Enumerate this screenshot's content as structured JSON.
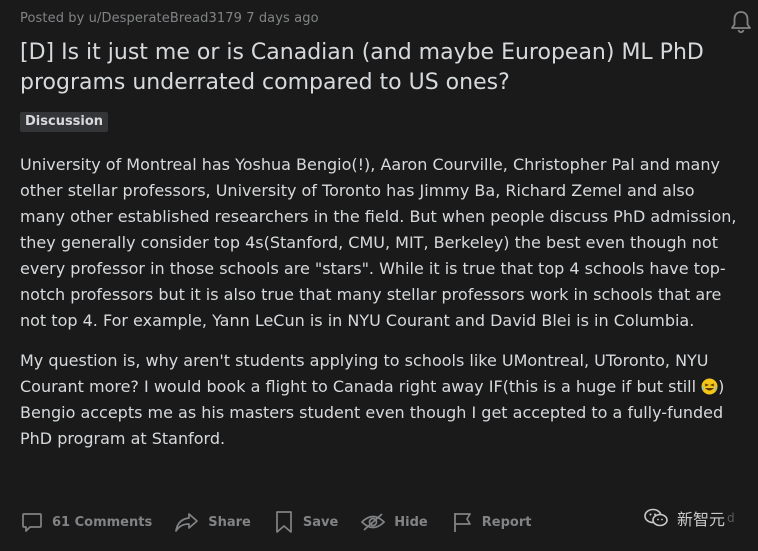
{
  "post": {
    "author_line": "Posted by u/DesperateBread3179 7 days ago",
    "title": "[D] Is it just me or is Canadian (and maybe European) ML PhD programs underrated compared to US ones?",
    "flair": "Discussion",
    "paragraph1": "University of Montreal has Yoshua Bengio(!), Aaron Courville, Christopher Pal and many other stellar professors, University of Toronto has Jimmy Ba, Richard Zemel and also many other established researchers in the field. But when people discuss PhD admission, they generally consider top 4s(Stanford, CMU, MIT, Berkeley) the best even though not every professor in those schools are \"stars\". While it is true that top 4 schools have top-notch professors but it is also true that many stellar professors work in schools that are not top 4. For example, Yann LeCun is in NYU Courant and David Blei is in Columbia.",
    "paragraph2_a": "My question is, why aren't students applying to schools like UMontreal, UToronto, NYU Courant more? I would book a flight to Canada right away IF(this is a huge if but still",
    "paragraph2_b": ") Bengio accepts me as his masters student even though I get accepted to a fully-funded PhD program at Stanford."
  },
  "actions": {
    "comments": "61 Comments",
    "share": "Share",
    "save": "Save",
    "hide": "Hide",
    "report": "Report"
  },
  "watermark": {
    "text": "新智元",
    "faded_text": "d"
  },
  "icons": [
    "bell-icon",
    "comment-icon",
    "share-icon",
    "save-icon",
    "hide-icon",
    "report-icon",
    "laughing-emoji-icon",
    "wechat-logo-icon"
  ]
}
